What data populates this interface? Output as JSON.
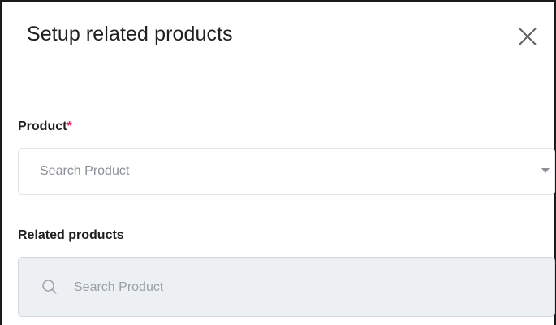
{
  "dialog": {
    "title": "Setup related products"
  },
  "product_field": {
    "label": "Product",
    "required_mark": "*",
    "placeholder": "Search Product"
  },
  "related_field": {
    "label": "Related products",
    "placeholder": "Search Product"
  },
  "icons": {
    "close": "close-icon",
    "caret": "chevron-down-icon",
    "search": "search-icon"
  },
  "colors": {
    "required": "#e5245d",
    "search_background": "#edf0f3"
  }
}
